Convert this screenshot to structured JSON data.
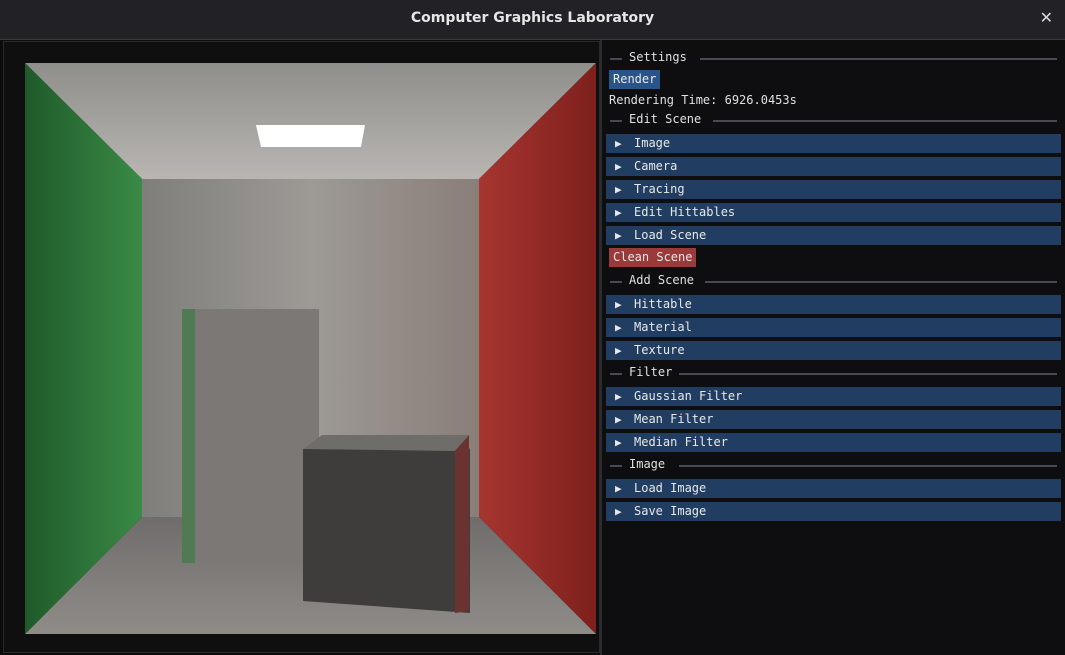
{
  "window": {
    "title": "Computer Graphics Laboratory",
    "close_icon": "close-icon"
  },
  "settings": {
    "label": "Settings",
    "render_label": "Render",
    "rendering_time_label": "Rendering Time: 6926.0453s"
  },
  "edit_scene": {
    "label": "Edit Scene",
    "items": [
      {
        "label": "Image"
      },
      {
        "label": "Camera"
      },
      {
        "label": "Tracing"
      },
      {
        "label": "Edit Hittables"
      },
      {
        "label": "Load Scene"
      }
    ],
    "clean_label": "Clean Scene"
  },
  "add_scene": {
    "label": "Add Scene",
    "items": [
      {
        "label": "Hittable"
      },
      {
        "label": "Material"
      },
      {
        "label": "Texture"
      }
    ]
  },
  "filter": {
    "label": "Filter",
    "items": [
      {
        "label": "Gaussian Filter"
      },
      {
        "label": "Mean Filter"
      },
      {
        "label": "Median Filter"
      }
    ]
  },
  "image": {
    "label": "Image",
    "items": [
      {
        "label": "Load Image"
      },
      {
        "label": "Save Image"
      }
    ]
  },
  "colors": {
    "header": "#213e62",
    "button": "#2a5488",
    "danger_button": "#9b3a3a",
    "left_wall": "#2e7a3c",
    "right_wall": "#9a2a26"
  }
}
